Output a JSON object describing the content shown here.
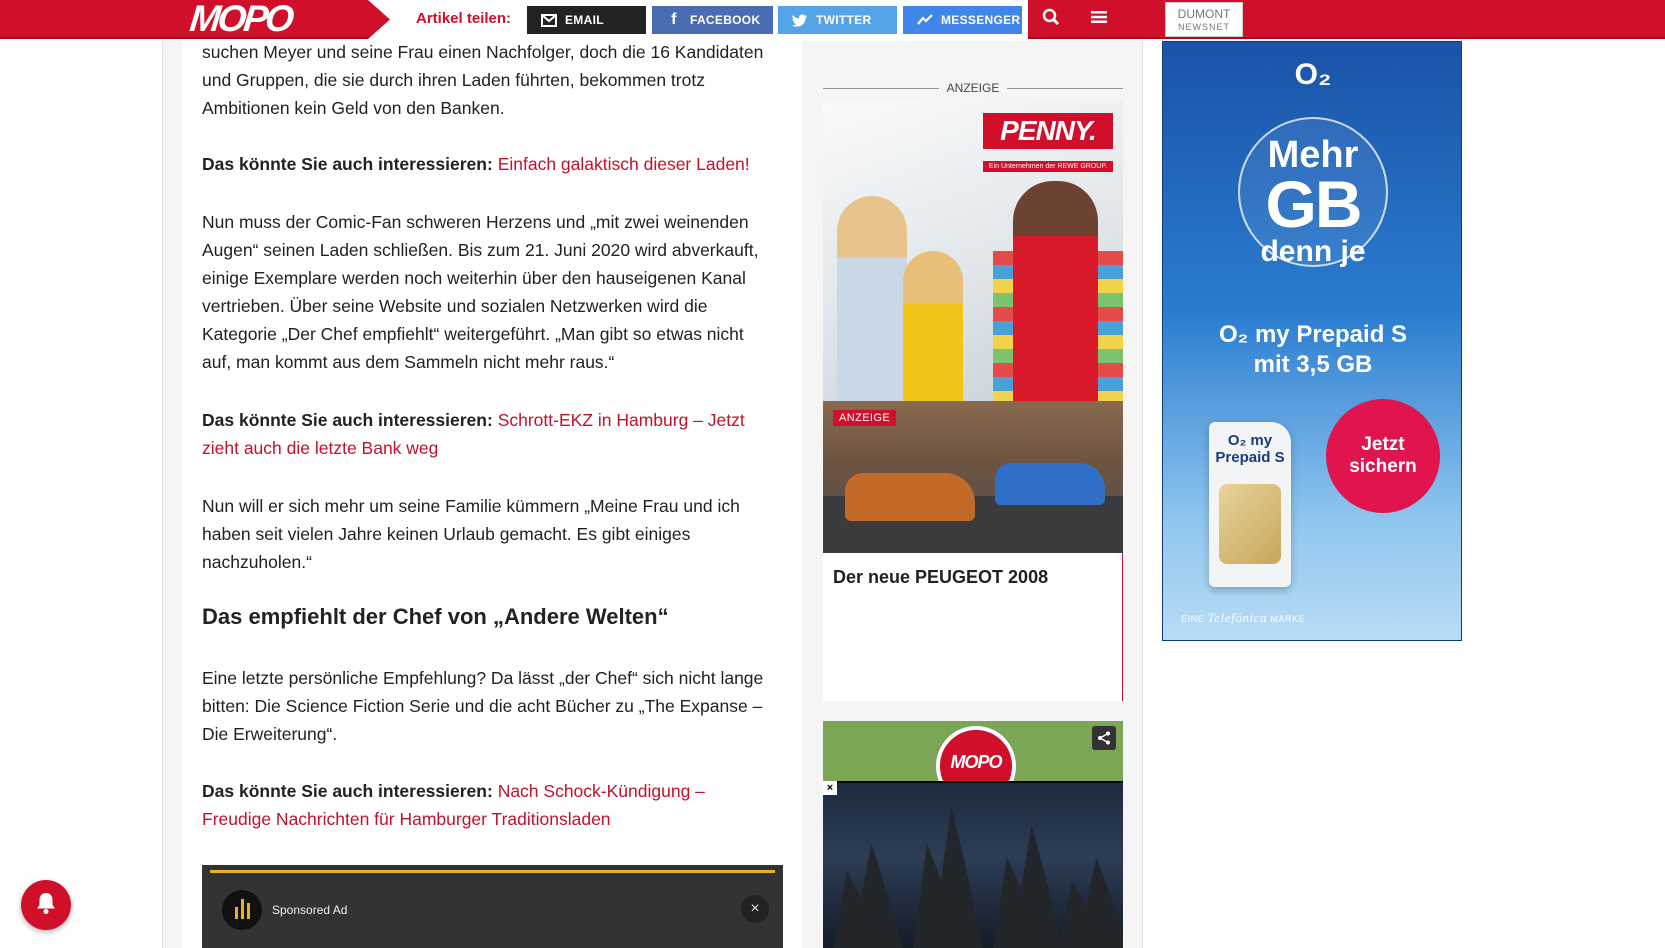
{
  "topbar": {
    "logo": "MOPO",
    "share_label": "Artikel teilen:",
    "buttons": {
      "email": "EMAIL",
      "facebook": "FACEBOOK",
      "twitter": "TWITTER",
      "messenger": "MESSENGER"
    },
    "dumont": {
      "line1": "DUMONT",
      "line2": "NEWSNET"
    }
  },
  "article": {
    "p1": "suchen Meyer und seine Frau einen Nachfolger, doch die 16 Kandidaten und Gruppen, die sie durch ihren Laden führten, bekommen trotz Ambitionen kein Geld von den Banken.",
    "rel_prefix": "Das könnte Sie auch interessieren:",
    "rel1": "Einfach galaktisch dieser Laden!",
    "p2": "Nun muss der Comic-Fan schweren Herzens und „mit zwei weinenden Augen“ seinen Laden schließen. Bis zum 21. Juni 2020 wird abverkauft, einige Exemplare werden noch weiterhin über den hauseigenen Kanal vertrieben. Über seine Website und sozialen Netzwerken wird die Kategorie „Der Chef empfiehlt“ weitergeführt. „Man gibt so etwas nicht auf, man kommt aus dem Sammeln nicht mehr raus.“",
    "rel2": "Schrott-EKZ in Hamburg – Jetzt zieht auch die letzte Bank weg",
    "p3": "Nun will er sich mehr um seine Familie kümmern „Meine Frau und ich haben seit vielen Jahre keinen Urlaub gemacht. Es gibt einiges nachzuholen.“",
    "h2": "Das empfiehlt der Chef von „Andere Welten“",
    "p4": "Eine letzte persönliche Empfehlung? Da lässt „der Chef“ sich nicht lange bitten: Die Science Fiction Serie und die acht Bücher zu „The Expanse – Die Erweiterung“.",
    "rel3": "Nach Schock-Kündigung – Freudige Nachrichten für Hamburger Traditionsladen",
    "player_label": "Sponsored Ad"
  },
  "sidebar": {
    "anzeige": "ANZEIGE",
    "penny_logo": "PENNY.",
    "penny_sub": "Ein Unternehmen der REWE GROUP.",
    "peugeot_tag": "ANZEIGE",
    "peugeot_title": "Der neue PEUGEOT 2008",
    "video_logo": "MOPO",
    "video_close": "×"
  },
  "o2ad": {
    "brand": "O₂",
    "mehr": "Mehr",
    "gb": "GB",
    "denn": "denn je",
    "product": "O₂ my Prepaid S",
    "product2": "mit 3,5 GB",
    "sim_text": "O₂ my Prepaid S",
    "cta": "Jetzt sichern",
    "footer_pre": "EINE",
    "footer_brand": "Telefónica",
    "footer_post": "MARKE"
  },
  "colors": {
    "brand_red": "#d0102b",
    "link_red": "#c0122c",
    "facebook": "#4a6cb3",
    "twitter": "#55a4e8",
    "messenger": "#3f86e8"
  }
}
